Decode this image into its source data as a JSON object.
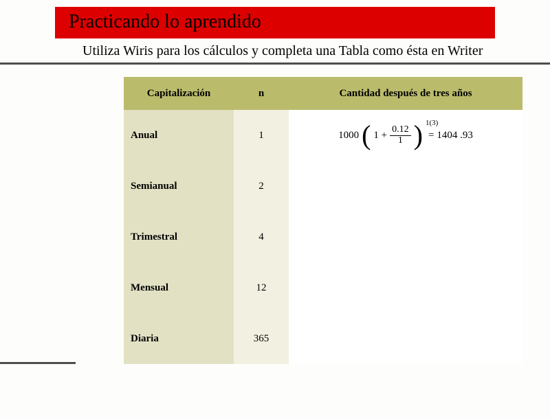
{
  "title": "Practicando lo aprendido",
  "subtitle": "Utiliza Wiris para los cálculos y completa una Tabla como ésta en Writer",
  "table": {
    "headers": {
      "capitalization": "Capitalización",
      "n": "n",
      "amount": "Cantidad después de tres años"
    },
    "rows": [
      {
        "label": "Anual",
        "n": "1"
      },
      {
        "label": "Semianual",
        "n": "2"
      },
      {
        "label": "Trimestral",
        "n": "4"
      },
      {
        "label": "Mensual",
        "n": "12"
      },
      {
        "label": "Diaria",
        "n": "365"
      }
    ]
  },
  "chart_data": {
    "type": "table",
    "title": "Capitalización compuesta después de tres años",
    "columns": [
      "Capitalización",
      "n",
      "Cantidad después de tres años"
    ],
    "rows": [
      [
        "Anual",
        1,
        "1000(1 + 0.12/1)^(1·3) = 1404.93"
      ],
      [
        "Semianual",
        2,
        ""
      ],
      [
        "Trimestral",
        4,
        ""
      ],
      [
        "Mensual",
        12,
        ""
      ],
      [
        "Diaria",
        365,
        ""
      ]
    ]
  },
  "formula": {
    "base": "1000",
    "inner_left": "1 +",
    "frac_num": "0.12",
    "frac_den": "1",
    "exponent": "1(3)",
    "result_sep": "=",
    "result": "1404 .93"
  }
}
